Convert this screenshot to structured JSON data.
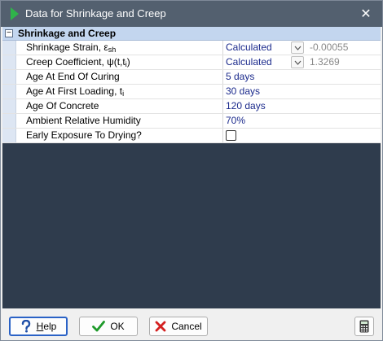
{
  "window": {
    "title": "Data for Shrinkage and Creep",
    "close_glyph": "✕"
  },
  "section": {
    "expander": "−",
    "title": "Shrinkage and Creep"
  },
  "rows": [
    {
      "label": "Shrinkage Strain, ε",
      "label_sub": "sh",
      "value": "Calculated",
      "computed": "-0.00055"
    },
    {
      "label": "Creep Coefficient, ψ(t,t",
      "label_sub": "i",
      "label_tail": ")",
      "value": "Calculated",
      "computed": "1.3269"
    },
    {
      "label": "Age At End Of Curing",
      "value": "5 days"
    },
    {
      "label": "Age At First Loading, t",
      "label_sub": "i",
      "value": "30 days"
    },
    {
      "label": "Age Of Concrete",
      "value": "120 days"
    },
    {
      "label": "Ambient Relative Humidity",
      "value": "70%"
    },
    {
      "label": "Early Exposure To Drying?",
      "checked": false
    }
  ],
  "buttons": {
    "help": {
      "label_first": "H",
      "label_rest": "elp",
      "icon": "question-icon"
    },
    "ok": {
      "label": "OK",
      "icon": "checkmark-icon"
    },
    "cancel": {
      "label": "Cancel",
      "icon": "x-icon"
    },
    "calculator": {
      "icon": "calculator-icon"
    }
  },
  "colors": {
    "titlebar": "#53606f",
    "section_header": "#c3d6ef",
    "value_text": "#1b2a8c",
    "empty_area": "#2f3c4d",
    "ok_check": "#1e9a2a",
    "cancel_x": "#d42020"
  }
}
